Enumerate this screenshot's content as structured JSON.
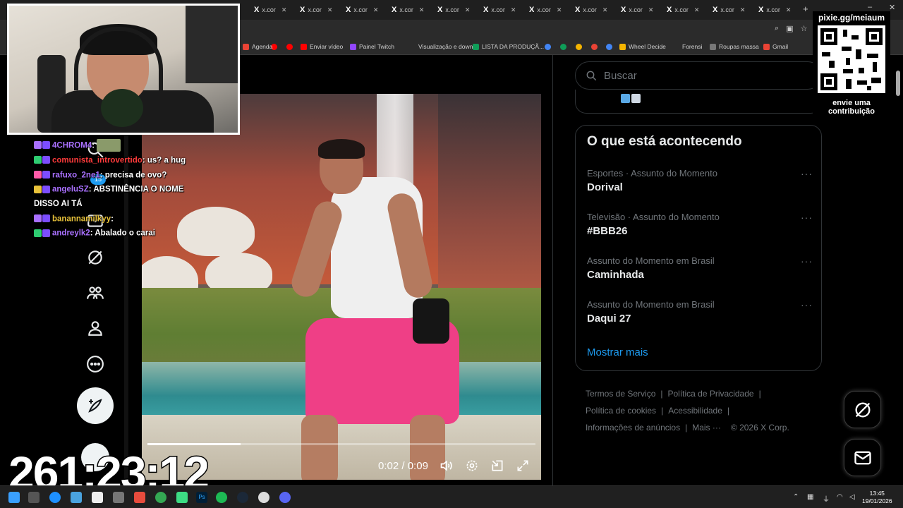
{
  "browser": {
    "tabs": [
      {
        "label": "x.cor"
      },
      {
        "label": "x.cor"
      },
      {
        "label": "x.cor"
      },
      {
        "label": "x.cor"
      },
      {
        "label": "x.cor"
      },
      {
        "label": "x.cor"
      },
      {
        "label": "x.cor"
      },
      {
        "label": "x.cor"
      },
      {
        "label": "x.cor"
      },
      {
        "label": "x.cor"
      },
      {
        "label": "x.cor"
      },
      {
        "label": "x.cor"
      }
    ],
    "new_tab": "+",
    "bookmarks": [
      {
        "label": "Agenda",
        "color": "#ea4335"
      },
      {
        "label": "Enviar vídeo",
        "color": "#ff0000"
      },
      {
        "label": "Painel Twitch",
        "color": "#9146ff"
      },
      {
        "label": "Visualização e down...",
        "color": ""
      },
      {
        "label": "LISTA DA PRODUÇÃ...",
        "color": "#0f9d58"
      },
      {
        "label": "Wheel Decide",
        "color": "#f4b400"
      },
      {
        "label": "Forensi",
        "color": ""
      },
      {
        "label": "Roupas massa",
        "color": "#777777"
      },
      {
        "label": "Gmail",
        "color": "#ea4335"
      }
    ]
  },
  "nav": {
    "notification_count": "15"
  },
  "video": {
    "current_time": "0:02",
    "separator": "/",
    "duration": "0:09",
    "progress": 0.24
  },
  "search": {
    "placeholder": "Buscar"
  },
  "trends": {
    "title": "O que está acontecendo",
    "items": [
      {
        "meta": "Esportes · Assunto do Momento",
        "name": "Dorival"
      },
      {
        "meta": "Televisão · Assunto do Momento",
        "name": "#BBB26"
      },
      {
        "meta": "Assunto do Momento em Brasil",
        "name": "Caminhada"
      },
      {
        "meta": "Assunto do Momento em Brasil",
        "name": "Daqui 27"
      }
    ],
    "more_icon": "···",
    "show_more": "Mostrar mais"
  },
  "footer": {
    "links": [
      "Termos de Serviço",
      "Política de Privacidade",
      "Política de cookies",
      "Acessibilidade",
      "Informações de anúncios",
      "Mais ···"
    ],
    "sep": "|",
    "copyright": "© 2026 X Corp."
  },
  "stream": {
    "qr_title": "pixie.gg/meiaum",
    "qr_caption_1": "envie uma",
    "qr_caption_2": "contribuição",
    "timer": "261:23:12",
    "chat": [
      {
        "user": "4CHROM4",
        "user_color": "#a970ff",
        "text": "",
        "emote": true
      },
      {
        "user": "comunista_introvertido",
        "user_color": "#ff3b3b",
        "text": "us? a hug",
        "emote": false
      },
      {
        "user": "rafuxo_2ne1",
        "user_color": "#a970ff",
        "text": "precisa de ovo?",
        "emote": false
      },
      {
        "user": "angeluSZ",
        "user_color": "#a970ff",
        "text": "ABSTINÊNCIA O NOME DISSO AI TÁ",
        "emote": false
      },
      {
        "user": "banannamilkyy",
        "user_color": "#e8c23a",
        "text": "",
        "emote": false
      },
      {
        "user": "andreylk2",
        "user_color": "#a970ff",
        "text": "Abalado o carai",
        "emote": false
      }
    ]
  },
  "taskbar": {
    "time": "13:45",
    "date": "19/01/2026"
  }
}
